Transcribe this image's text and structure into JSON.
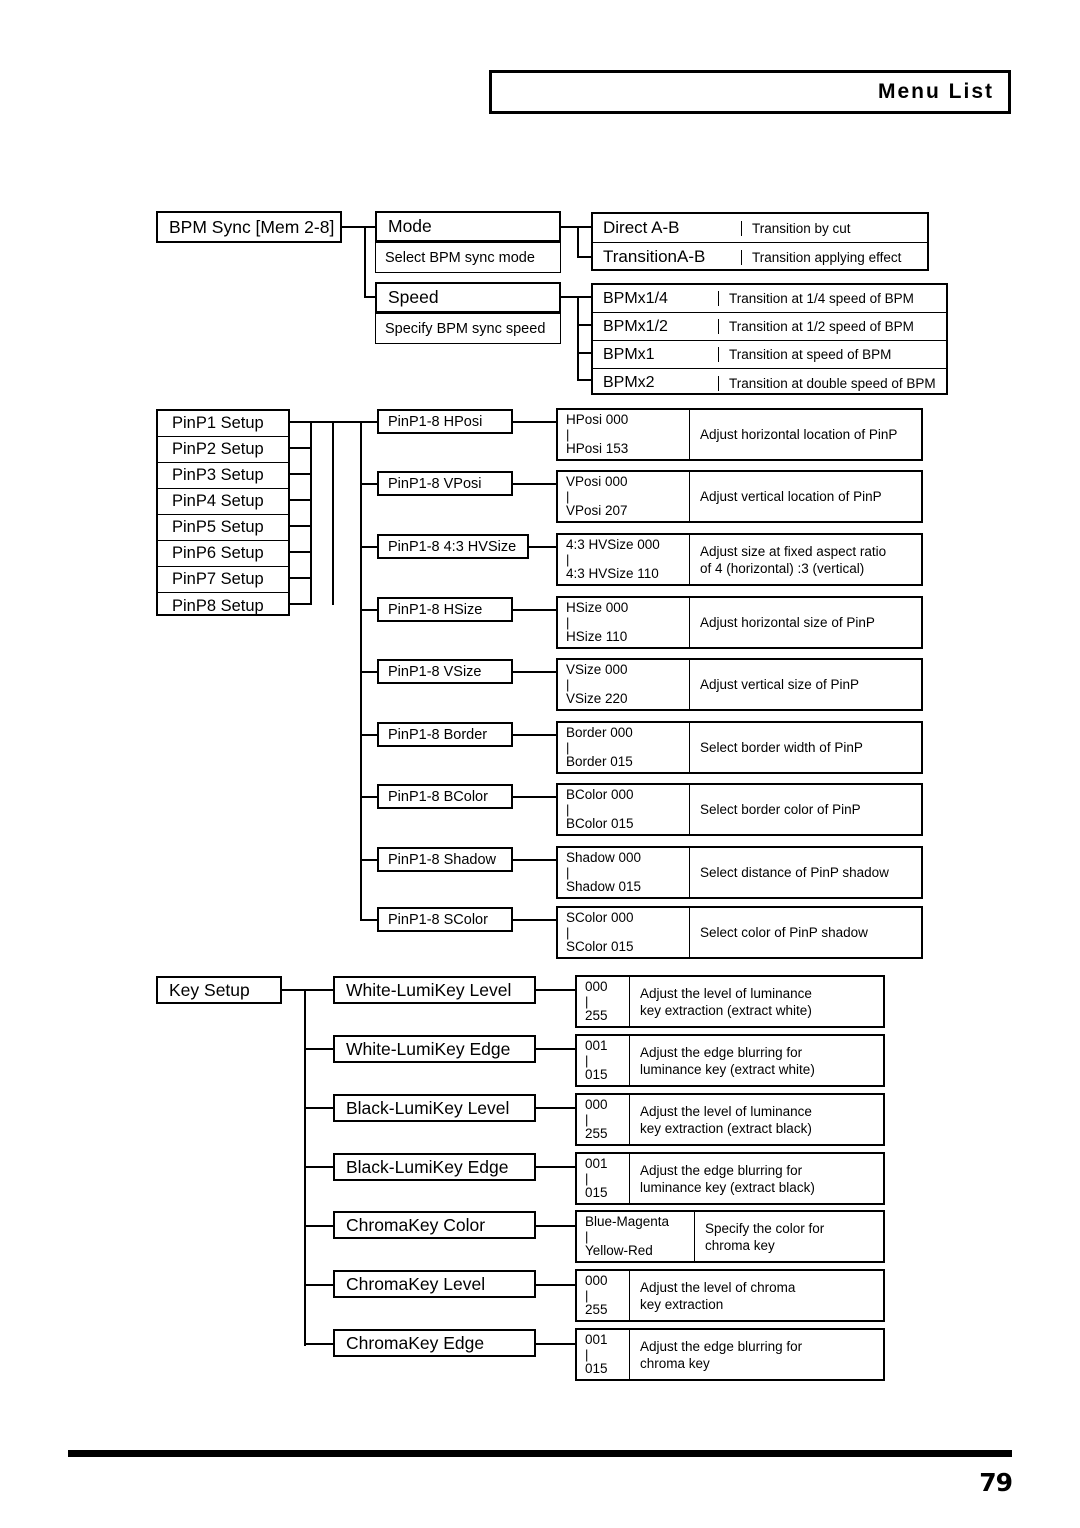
{
  "header": {
    "title": "Menu List"
  },
  "footer": {
    "page_number": "79"
  },
  "bpm_sync": {
    "root_label": "BPM Sync  [Mem 2-8]",
    "mode": {
      "label": "Mode",
      "desc": "Select BPM sync mode",
      "options": [
        {
          "name": "Direct A-B",
          "desc": "Transition by cut"
        },
        {
          "name": "TransitionA-B",
          "desc": "Transition applying effect"
        }
      ]
    },
    "speed": {
      "label": "Speed",
      "desc": "Specify BPM sync speed",
      "options": [
        {
          "name": "BPMx1/4",
          "desc": "Transition at 1/4 speed of BPM"
        },
        {
          "name": "BPMx1/2",
          "desc": "Transition at 1/2 speed of BPM"
        },
        {
          "name": "BPMx1",
          "desc": "Transition at speed of BPM"
        },
        {
          "name": "BPMx2",
          "desc": "Transition at double speed of BPM"
        }
      ]
    }
  },
  "pinp_setup": {
    "roots": [
      "PinP1 Setup",
      "PinP2 Setup",
      "PinP3 Setup",
      "PinP4 Setup",
      "PinP5 Setup",
      "PinP6 Setup",
      "PinP7 Setup",
      "PinP8 Setup"
    ],
    "params": [
      {
        "label": "PinP1-8  HPosi",
        "min": "HPosi  000",
        "max": "HPosi  153",
        "desc1": "Adjust horizontal location of PinP",
        "desc2": ""
      },
      {
        "label": "PinP1-8  VPosi",
        "min": "VPosi  000",
        "max": "VPosi  207",
        "desc1": "Adjust vertical location of PinP",
        "desc2": ""
      },
      {
        "label": "PinP1-8  4:3 HVSize",
        "min": "4:3 HVSize  000",
        "max": "4:3 HVSize  110",
        "desc1": "Adjust size at fixed aspect ratio",
        "desc2": "of 4 (horizontal) :3 (vertical)"
      },
      {
        "label": "PinP1-8  HSize",
        "min": "HSize  000",
        "max": "HSize  110",
        "desc1": "Adjust horizontal size of PinP",
        "desc2": ""
      },
      {
        "label": "PinP1-8  VSize",
        "min": "VSize  000",
        "max": "VSize  220",
        "desc1": "Adjust vertical size of PinP",
        "desc2": ""
      },
      {
        "label": "PinP1-8  Border",
        "min": "Border  000",
        "max": "Border  015",
        "desc1": "Select border width of PinP",
        "desc2": ""
      },
      {
        "label": "PinP1-8  BColor",
        "min": "BColor  000",
        "max": "BColor  015",
        "desc1": "Select border color of PinP",
        "desc2": ""
      },
      {
        "label": "PinP1-8  Shadow",
        "min": "Shadow  000",
        "max": "Shadow  015",
        "desc1": "Select distance of PinP shadow",
        "desc2": ""
      },
      {
        "label": "PinP1-8  SColor",
        "min": "SColor  000",
        "max": "SColor  015",
        "desc1": "Select color of PinP shadow",
        "desc2": ""
      }
    ]
  },
  "key_setup": {
    "root_label": "Key Setup",
    "params": [
      {
        "label": "White-LumiKey Level",
        "min": "000",
        "max": "255",
        "desc1": "Adjust the level of luminance",
        "desc2": "key extraction (extract white)"
      },
      {
        "label": "White-LumiKey Edge",
        "min": "001",
        "max": "015",
        "desc1": "Adjust the edge blurring for",
        "desc2": "luminance key (extract white)"
      },
      {
        "label": "Black-LumiKey Level",
        "min": "000",
        "max": "255",
        "desc1": "Adjust the level of luminance",
        "desc2": "key extraction (extract black)"
      },
      {
        "label": "Black-LumiKey Edge",
        "min": "001",
        "max": "015",
        "desc1": "Adjust the edge blurring for",
        "desc2": "luminance key (extract black)"
      },
      {
        "label": "ChromaKey Color",
        "min": "Blue-Magenta",
        "max": "Yellow-Red",
        "desc1": "Specify the color for",
        "desc2": "chroma key"
      },
      {
        "label": "ChromaKey Level",
        "min": "000",
        "max": "255",
        "desc1": "Adjust the level of chroma",
        "desc2": "key extraction"
      },
      {
        "label": "ChromaKey Edge",
        "min": "001",
        "max": "015",
        "desc1": "Adjust the edge blurring for",
        "desc2": "chroma key"
      }
    ]
  }
}
